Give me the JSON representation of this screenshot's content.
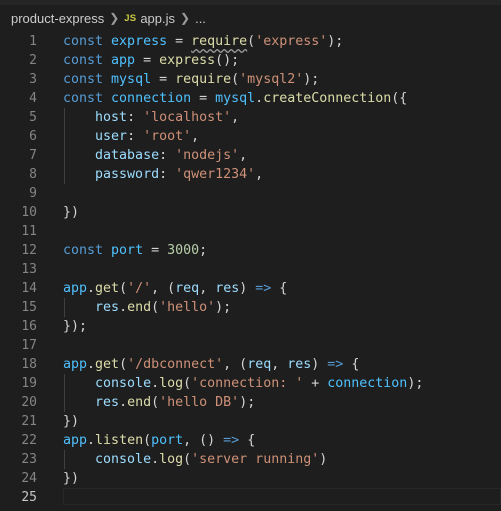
{
  "breadcrumb": {
    "folder": "product-express",
    "separator_icon": "chevron-right-icon",
    "file_badge": "JS",
    "file": "app.js",
    "more": "..."
  },
  "editor": {
    "language": "javascript",
    "active_line": 25,
    "colors": {
      "background": "#1e1e1e",
      "keyword": "#569cd6",
      "constant": "#4fc1ff",
      "variable": "#9cdcfe",
      "function": "#dcdcaa",
      "string": "#ce9178",
      "number": "#b5cea8",
      "line_number": "#858585"
    },
    "lines": [
      {
        "n": "1",
        "tokens": [
          [
            "kw",
            "const"
          ],
          [
            "punc",
            " "
          ],
          [
            "var",
            "express"
          ],
          [
            "punc",
            " = "
          ],
          [
            "fn",
            "require"
          ],
          [
            "punc",
            "("
          ],
          [
            "str",
            "'express'"
          ],
          [
            "punc",
            ");"
          ]
        ]
      },
      {
        "n": "2",
        "tokens": [
          [
            "kw",
            "const"
          ],
          [
            "punc",
            " "
          ],
          [
            "var",
            "app"
          ],
          [
            "punc",
            " = "
          ],
          [
            "fn",
            "express"
          ],
          [
            "punc",
            "();"
          ]
        ]
      },
      {
        "n": "3",
        "tokens": [
          [
            "kw",
            "const"
          ],
          [
            "punc",
            " "
          ],
          [
            "var",
            "mysql"
          ],
          [
            "punc",
            " = "
          ],
          [
            "fn",
            "require"
          ],
          [
            "punc",
            "("
          ],
          [
            "str",
            "'mysql2'"
          ],
          [
            "punc",
            ");"
          ]
        ]
      },
      {
        "n": "4",
        "tokens": [
          [
            "kw",
            "const"
          ],
          [
            "punc",
            " "
          ],
          [
            "var",
            "connection"
          ],
          [
            "punc",
            " = "
          ],
          [
            "var",
            "mysql"
          ],
          [
            "punc",
            "."
          ],
          [
            "fn",
            "createConnection"
          ],
          [
            "punc",
            "({"
          ]
        ]
      },
      {
        "n": "5",
        "tokens": [
          [
            "punc",
            "    "
          ],
          [
            "id",
            "host"
          ],
          [
            "punc",
            ": "
          ],
          [
            "str",
            "'localhost'"
          ],
          [
            "punc",
            ","
          ]
        ]
      },
      {
        "n": "6",
        "tokens": [
          [
            "punc",
            "    "
          ],
          [
            "id",
            "user"
          ],
          [
            "punc",
            ": "
          ],
          [
            "str",
            "'root'"
          ],
          [
            "punc",
            ","
          ]
        ]
      },
      {
        "n": "7",
        "tokens": [
          [
            "punc",
            "    "
          ],
          [
            "id",
            "database"
          ],
          [
            "punc",
            ": "
          ],
          [
            "str",
            "'nodejs'"
          ],
          [
            "punc",
            ","
          ]
        ]
      },
      {
        "n": "8",
        "tokens": [
          [
            "punc",
            "    "
          ],
          [
            "id",
            "password"
          ],
          [
            "punc",
            ": "
          ],
          [
            "str",
            "'qwer1234'"
          ],
          [
            "punc",
            ","
          ]
        ]
      },
      {
        "n": "9",
        "tokens": []
      },
      {
        "n": "10",
        "tokens": [
          [
            "punc",
            "})"
          ]
        ]
      },
      {
        "n": "11",
        "tokens": []
      },
      {
        "n": "12",
        "tokens": [
          [
            "kw",
            "const"
          ],
          [
            "punc",
            " "
          ],
          [
            "var",
            "port"
          ],
          [
            "punc",
            " = "
          ],
          [
            "num",
            "3000"
          ],
          [
            "punc",
            ";"
          ]
        ]
      },
      {
        "n": "13",
        "tokens": []
      },
      {
        "n": "14",
        "tokens": [
          [
            "var",
            "app"
          ],
          [
            "punc",
            "."
          ],
          [
            "fn",
            "get"
          ],
          [
            "punc",
            "("
          ],
          [
            "str",
            "'/'"
          ],
          [
            "punc",
            ", ("
          ],
          [
            "id",
            "req"
          ],
          [
            "punc",
            ", "
          ],
          [
            "id",
            "res"
          ],
          [
            "punc",
            ") "
          ],
          [
            "kw",
            "=>"
          ],
          [
            "punc",
            " {"
          ]
        ]
      },
      {
        "n": "15",
        "tokens": [
          [
            "punc",
            "    "
          ],
          [
            "id",
            "res"
          ],
          [
            "punc",
            "."
          ],
          [
            "fn",
            "end"
          ],
          [
            "punc",
            "("
          ],
          [
            "str",
            "'hello'"
          ],
          [
            "punc",
            ");"
          ]
        ]
      },
      {
        "n": "16",
        "tokens": [
          [
            "punc",
            "});"
          ]
        ]
      },
      {
        "n": "17",
        "tokens": []
      },
      {
        "n": "18",
        "tokens": [
          [
            "var",
            "app"
          ],
          [
            "punc",
            "."
          ],
          [
            "fn",
            "get"
          ],
          [
            "punc",
            "("
          ],
          [
            "str",
            "'/dbconnect'"
          ],
          [
            "punc",
            ", ("
          ],
          [
            "id",
            "req"
          ],
          [
            "punc",
            ", "
          ],
          [
            "id",
            "res"
          ],
          [
            "punc",
            ") "
          ],
          [
            "kw",
            "=>"
          ],
          [
            "punc",
            " {"
          ]
        ]
      },
      {
        "n": "19",
        "tokens": [
          [
            "punc",
            "    "
          ],
          [
            "id",
            "console"
          ],
          [
            "punc",
            "."
          ],
          [
            "fn",
            "log"
          ],
          [
            "punc",
            "("
          ],
          [
            "str",
            "'connection: '"
          ],
          [
            "punc",
            " + "
          ],
          [
            "var",
            "connection"
          ],
          [
            "punc",
            ");"
          ]
        ]
      },
      {
        "n": "20",
        "tokens": [
          [
            "punc",
            "    "
          ],
          [
            "id",
            "res"
          ],
          [
            "punc",
            "."
          ],
          [
            "fn",
            "end"
          ],
          [
            "punc",
            "("
          ],
          [
            "str",
            "'hello DB'"
          ],
          [
            "punc",
            ");"
          ]
        ]
      },
      {
        "n": "21",
        "tokens": [
          [
            "punc",
            "})"
          ]
        ]
      },
      {
        "n": "22",
        "tokens": [
          [
            "var",
            "app"
          ],
          [
            "punc",
            "."
          ],
          [
            "fn",
            "listen"
          ],
          [
            "punc",
            "("
          ],
          [
            "var",
            "port"
          ],
          [
            "punc",
            ", () "
          ],
          [
            "kw",
            "=>"
          ],
          [
            "punc",
            " {"
          ]
        ]
      },
      {
        "n": "23",
        "tokens": [
          [
            "punc",
            "    "
          ],
          [
            "id",
            "console"
          ],
          [
            "punc",
            "."
          ],
          [
            "fn",
            "log"
          ],
          [
            "punc",
            "("
          ],
          [
            "str",
            "'server running'"
          ],
          [
            "punc",
            ")"
          ]
        ]
      },
      {
        "n": "24",
        "tokens": [
          [
            "punc",
            "})"
          ]
        ]
      },
      {
        "n": "25",
        "tokens": []
      }
    ]
  }
}
